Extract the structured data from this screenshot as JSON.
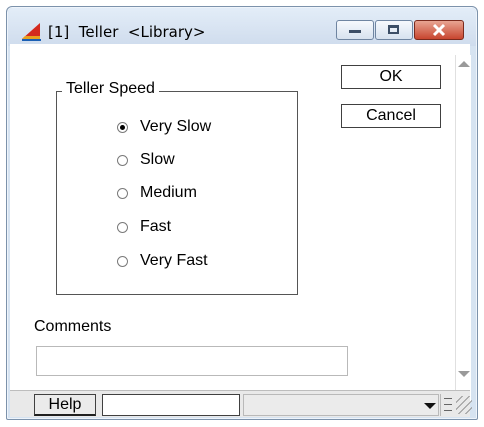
{
  "window": {
    "title": "[1]  Teller  <Library>",
    "icon": "app-triangle-icon",
    "colors": {
      "frame": "#d6e3f1",
      "close": "#c8452f"
    }
  },
  "caption_buttons": {
    "minimize": "minimize-icon",
    "maximize": "maximize-icon",
    "close": "close-icon"
  },
  "group": {
    "title": "Teller Speed",
    "options": [
      {
        "label": "Very Slow",
        "checked": true
      },
      {
        "label": "Slow",
        "checked": false
      },
      {
        "label": "Medium",
        "checked": false
      },
      {
        "label": "Fast",
        "checked": false
      },
      {
        "label": "Very Fast",
        "checked": false
      }
    ]
  },
  "buttons": {
    "ok": "OK",
    "cancel": "Cancel",
    "help": "Help"
  },
  "comments": {
    "label": "Comments",
    "value": ""
  },
  "status": {
    "field_value": "",
    "dropdown_value": ""
  }
}
